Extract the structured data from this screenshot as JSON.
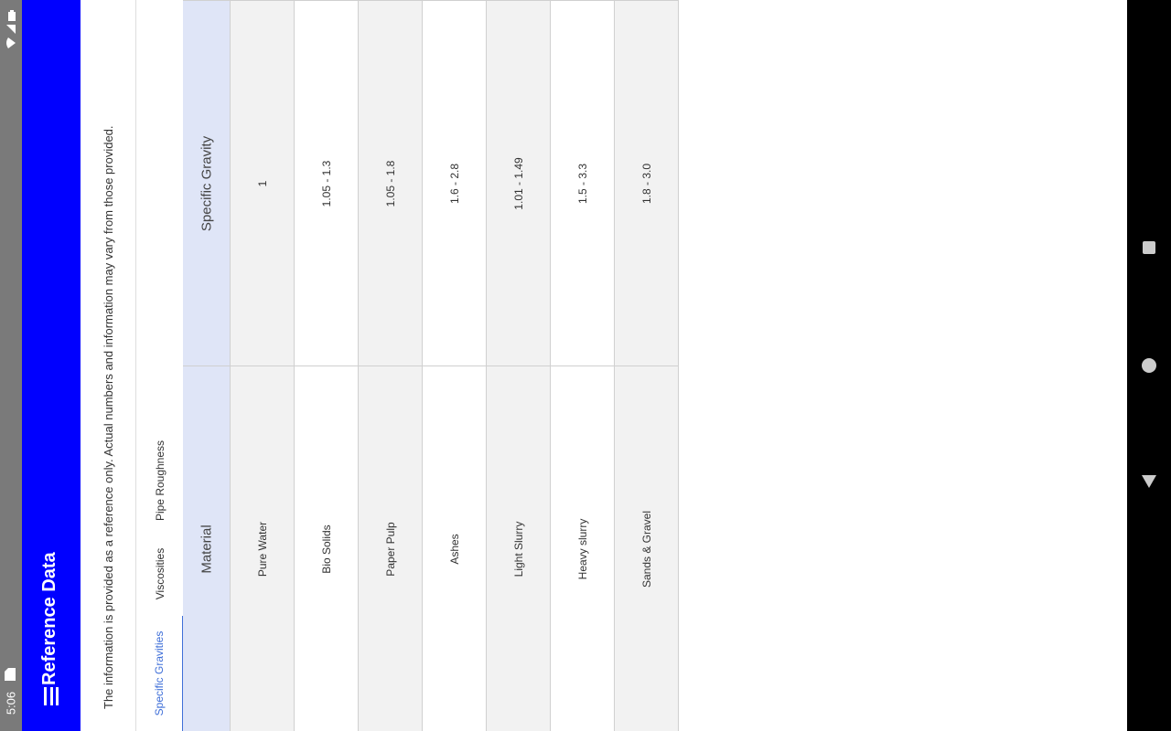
{
  "status_bar": {
    "time": "5:06",
    "icons": [
      "sim-card-icon",
      "wifi-icon",
      "signal-icon",
      "battery-icon"
    ]
  },
  "app_bar": {
    "title": "Reference Data",
    "menu_icon": "hamburger-menu-icon",
    "color": "#0000ff"
  },
  "disclaimer": "The information is provided as a reference only.  Actual numbers and information may vary from those provided.",
  "tabs": [
    {
      "label": "Specific Gravities",
      "active": true
    },
    {
      "label": "Viscosities",
      "active": false
    },
    {
      "label": "Pipe Roughness",
      "active": false
    }
  ],
  "table": {
    "headers": {
      "material": "Material",
      "specific_gravity": "Specific Gravity"
    },
    "rows": [
      {
        "material": "Pure Water",
        "specific_gravity": "1"
      },
      {
        "material": "Bio Solids",
        "specific_gravity": "1.05 - 1.3"
      },
      {
        "material": "Paper Pulp",
        "specific_gravity": "1.05 - 1.8"
      },
      {
        "material": "Ashes",
        "specific_gravity": "1.6 - 2.8"
      },
      {
        "material": "Light Slurry",
        "specific_gravity": "1.01 - 1.49"
      },
      {
        "material": "Heavy slurry",
        "specific_gravity": "1.5 - 3.3"
      },
      {
        "material": "Sands & Gravel",
        "specific_gravity": "1.8 - 3.0"
      }
    ]
  },
  "nav_bar": {
    "buttons": [
      "recents-square-icon",
      "home-circle-icon",
      "back-triangle-icon"
    ]
  },
  "colors": {
    "accent": "#3f6fd8",
    "header_bg": "#dfe5f7",
    "status_bar": "#7a7a7a",
    "nav_bar": "#000000"
  }
}
